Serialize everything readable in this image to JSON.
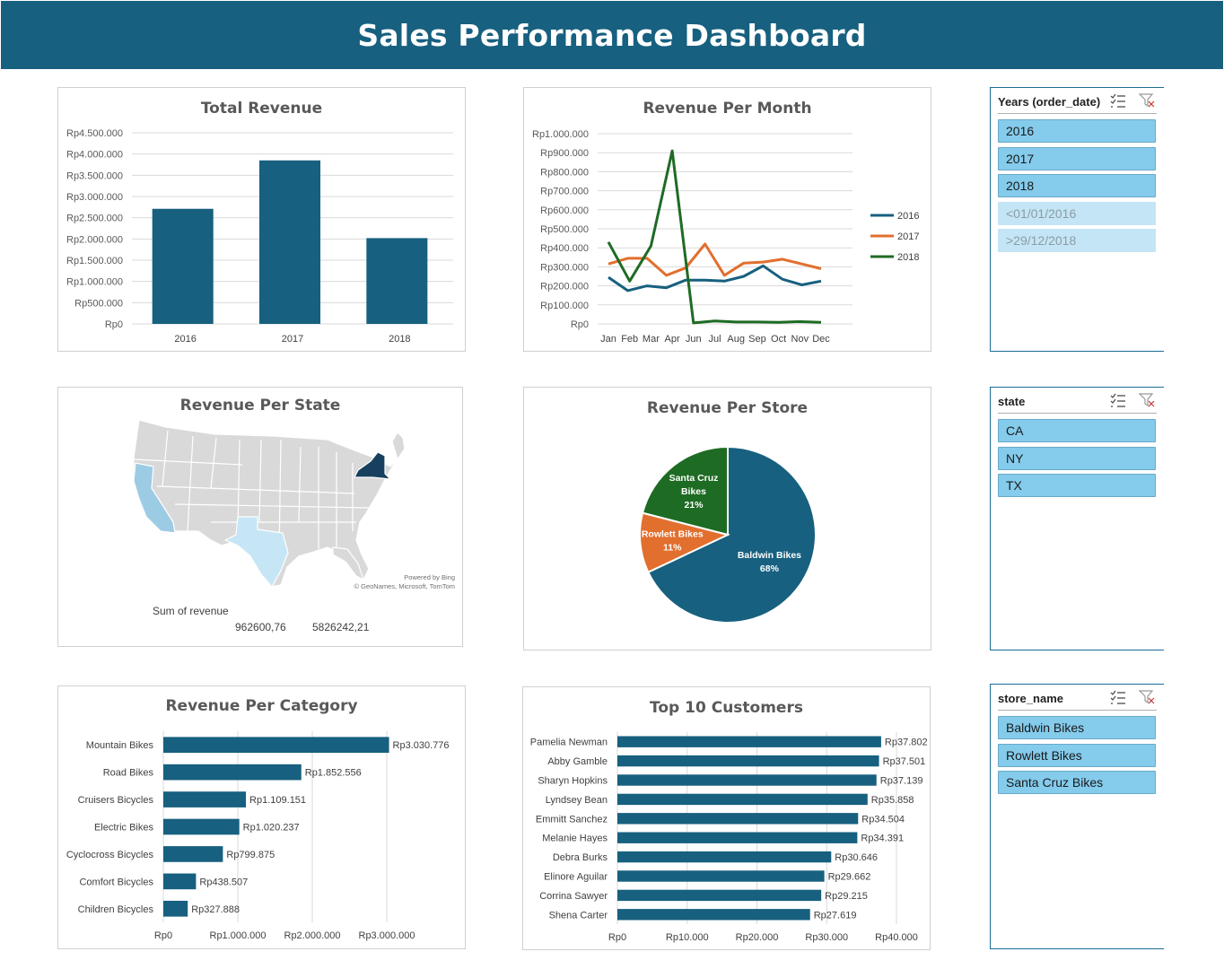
{
  "dashboard": {
    "title": "Sales Performance Dashboard"
  },
  "colors": {
    "primary": "#17607f",
    "orange": "#e26f2e",
    "green": "#1e6b24",
    "slicer_selected": "#84cbec",
    "slicer_dim": "#c4e5f5"
  },
  "charts": {
    "total_revenue": {
      "title": "Total Revenue",
      "chart_data": {
        "type": "bar",
        "categories": [
          "2016",
          "2017",
          "2018"
        ],
        "values": [
          2710000,
          3850000,
          2020000
        ],
        "ylim": [
          0,
          4500000
        ],
        "yticks": [
          "Rp0",
          "Rp500.000",
          "Rp1.000.000",
          "Rp1.500.000",
          "Rp2.000.000",
          "Rp2.500.000",
          "Rp3.000.000",
          "Rp3.500.000",
          "Rp4.000.000",
          "Rp4.500.000"
        ],
        "grid": true
      }
    },
    "revenue_per_month": {
      "title": "Revenue Per Month",
      "chart_data": {
        "type": "line",
        "categories": [
          "Jan",
          "Feb",
          "Mar",
          "Apr",
          "Jun",
          "Jul",
          "Aug",
          "Sep",
          "Oct",
          "Nov",
          "Dec"
        ],
        "series": [
          {
            "name": "2016",
            "color": "#17607f",
            "values": [
              245000,
              175000,
              200000,
              190000,
              230000,
              230000,
              225000,
              250000,
              305000,
              235000,
              205000,
              225000
            ]
          },
          {
            "name": "2017",
            "color": "#e26f2e",
            "values": [
              315000,
              345000,
              345000,
              255000,
              295000,
              420000,
              255000,
              320000,
              325000,
              340000,
              315000,
              290000
            ]
          },
          {
            "name": "2018",
            "color": "#1e6b24",
            "values": [
              430000,
              225000,
              410000,
              910000,
              5000,
              15000,
              10000,
              10000,
              8000,
              12000,
              8000
            ]
          }
        ],
        "ylim": [
          0,
          1000000
        ],
        "yticks": [
          "Rp0",
          "Rp100.000",
          "Rp200.000",
          "Rp300.000",
          "Rp400.000",
          "Rp500.000",
          "Rp600.000",
          "Rp700.000",
          "Rp800.000",
          "Rp900.000",
          "Rp1.000.000"
        ],
        "legend": "right",
        "grid": true
      }
    },
    "revenue_per_state": {
      "title": "Revenue Per State",
      "attribution": [
        "Powered by Bing",
        "© GeoNames, Microsoft, TomTom"
      ],
      "legend_title": "Sum of revenue",
      "legend_min": "962600,76",
      "legend_max": "5826242,21",
      "highlight": {
        "CA": "#9ccbe4",
        "NY": "#17405f",
        "TX": "#c6e6f6"
      }
    },
    "revenue_per_store": {
      "title": "Revenue Per Store",
      "chart_data": {
        "type": "pie",
        "slices": [
          {
            "label": "Baldwin Bikes",
            "percent": 68,
            "pct_label": "68%",
            "color": "#17607f"
          },
          {
            "label": "Rowlett Bikes",
            "percent": 11,
            "pct_label": "11%",
            "color": "#e26f2e"
          },
          {
            "label": "Santa Cruz Bikes",
            "percent": 21,
            "pct_label": "21%",
            "color": "#1e6b24"
          }
        ]
      }
    },
    "revenue_per_category": {
      "title": "Revenue Per Category",
      "chart_data": {
        "type": "bar",
        "orientation": "horizontal",
        "categories": [
          "Mountain Bikes",
          "Road Bikes",
          "Cruisers Bicycles",
          "Electric Bikes",
          "Cyclocross Bicycles",
          "Comfort Bicycles",
          "Children Bicycles"
        ],
        "values": [
          3030776,
          1852556,
          1109151,
          1020237,
          799875,
          438507,
          327888
        ],
        "data_labels": [
          "Rp3.030.776",
          "Rp1.852.556",
          "Rp1.109.151",
          "Rp1.020.237",
          "Rp799.875",
          "Rp438.507",
          "Rp327.888"
        ],
        "xlim": [
          0,
          3000000
        ],
        "xticks": [
          "Rp0",
          "Rp1.000.000",
          "Rp2.000.000",
          "Rp3.000.000"
        ],
        "grid": true
      }
    },
    "top_customers": {
      "title": "Top 10 Customers",
      "chart_data": {
        "type": "bar",
        "orientation": "horizontal",
        "categories": [
          "Pamelia Newman",
          "Abby Gamble",
          "Sharyn Hopkins",
          "Lyndsey Bean",
          "Emmitt Sanchez",
          "Melanie Hayes",
          "Debra Burks",
          "Elinore Aguilar",
          "Corrina Sawyer",
          "Shena Carter"
        ],
        "values": [
          37802,
          37501,
          37139,
          35858,
          34504,
          34391,
          30646,
          29662,
          29215,
          27619
        ],
        "data_labels": [
          "Rp37.802",
          "Rp37.501",
          "Rp37.139",
          "Rp35.858",
          "Rp34.504",
          "Rp34.391",
          "Rp30.646",
          "Rp29.662",
          "Rp29.215",
          "Rp27.619"
        ],
        "xlim": [
          0,
          40000
        ],
        "xticks": [
          "Rp0",
          "Rp10.000",
          "Rp20.000",
          "Rp30.000",
          "Rp40.000"
        ],
        "grid": true
      }
    }
  },
  "slicers": {
    "years": {
      "title": "Years (order_date)",
      "items": [
        {
          "label": "2016",
          "selected": true
        },
        {
          "label": "2017",
          "selected": true
        },
        {
          "label": "2018",
          "selected": true
        },
        {
          "label": "<01/01/2016",
          "selected": false
        },
        {
          "label": ">29/12/2018",
          "selected": false
        }
      ]
    },
    "state": {
      "title": "state",
      "items": [
        {
          "label": "CA",
          "selected": true
        },
        {
          "label": "NY",
          "selected": true
        },
        {
          "label": "TX",
          "selected": true
        }
      ]
    },
    "store": {
      "title": "store_name",
      "items": [
        {
          "label": "Baldwin Bikes",
          "selected": true
        },
        {
          "label": "Rowlett Bikes",
          "selected": true
        },
        {
          "label": "Santa Cruz Bikes",
          "selected": true
        }
      ]
    }
  }
}
